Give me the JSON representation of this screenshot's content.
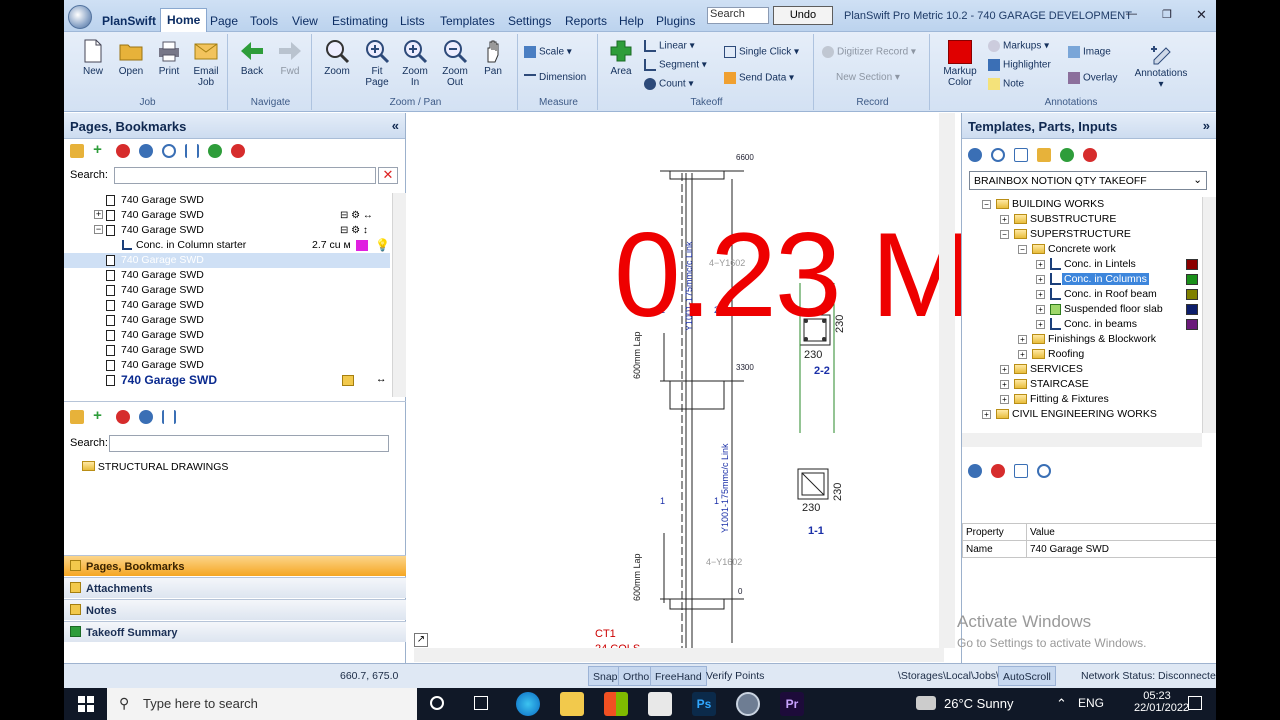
{
  "menubar": {
    "brand": "PlanSwift",
    "items": [
      "Home",
      "Page",
      "Tools",
      "View",
      "Estimating",
      "Lists",
      "Templates",
      "Settings",
      "Reports",
      "Help",
      "Plugins"
    ],
    "search_value": "Search",
    "undo": "Undo",
    "title": "PlanSwift Pro Metric 10.2 - 740 GARAGE DEVELOPMENT"
  },
  "ribbon": {
    "job": {
      "label": "Job",
      "new": "New",
      "open": "Open",
      "print": "Print",
      "email": "Email Job"
    },
    "navigate": {
      "label": "Navigate",
      "back": "Back",
      "fwd": "Fwd"
    },
    "zoom": {
      "label": "Zoom / Pan",
      "zoom": "Zoom",
      "fit": "Fit Page",
      "zoom_in": "Zoom In",
      "zoom_out": "Zoom Out",
      "pan": "Pan"
    },
    "measure": {
      "label": "Measure",
      "scale": "Scale",
      "dimension": "Dimension"
    },
    "takeoff": {
      "label": "Takeoff",
      "area": "Area",
      "linear": "Linear",
      "segment": "Segment",
      "count": "Count",
      "single_click": "Single Click",
      "send_data": "Send Data"
    },
    "record": {
      "label": "Record",
      "digitizer": "Digitizer Record",
      "new_section": "New Section"
    },
    "annotations": {
      "label": "Annotations",
      "markup_color": "Markup Color",
      "markups": "Markups",
      "highlighter": "Highlighter",
      "note": "Note",
      "image": "Image",
      "overlay": "Overlay",
      "annotations": "Annotations"
    }
  },
  "left_panel": {
    "title": "Pages, Bookmarks",
    "search_label": "Search:",
    "search_value": "",
    "pages": [
      {
        "name": "740 Garage SWD"
      },
      {
        "name": "740 Garage SWD"
      },
      {
        "name": "740 Garage SWD"
      },
      {
        "name": "Conc. in Column starter",
        "qty": "2.7 cu м"
      },
      {
        "name": "740 Garage SWD"
      },
      {
        "name": "740 Garage SWD"
      },
      {
        "name": "740 Garage SWD"
      },
      {
        "name": "740 Garage SWD"
      },
      {
        "name": "740 Garage SWD"
      },
      {
        "name": "740 Garage SWD"
      },
      {
        "name": "740 Garage SWD"
      },
      {
        "name": "740 Garage SWD"
      },
      {
        "name": "740 Garage SWD"
      }
    ],
    "search2_label": "Search:",
    "search2_value": "",
    "folders": [
      "STRUCTURAL DRAWINGS"
    ],
    "nav": [
      "Pages, Bookmarks",
      "Attachments",
      "Notes",
      "Takeoff Summary"
    ]
  },
  "canvas": {
    "overlay_value": "0.23 M",
    "labels": {
      "top_dim": "6600",
      "link1": "Y1001-175mmc/c Link",
      "mark1": "4−Y1602",
      "lap1": "600mm Lap",
      "lvl2": "3300",
      "link2": "Y1001-175mmc/c Link",
      "mark2": "4−Y1602",
      "lap2": "600mm Lap",
      "lvl0": "0",
      "sec22": "2-2",
      "sec11": "1-1",
      "dim230a": "230",
      "dim230b": "230",
      "dim230c": "230",
      "dim230d": "230",
      "ct1": "CT1",
      "cols": "24 COLS",
      "n2a": "2",
      "n2b": "2",
      "n1a": "1",
      "n1b": "1"
    }
  },
  "right_panel": {
    "title": "Templates, Parts, Inputs",
    "dropdown": "BRAINBOX NOTION QTY TAKEOFF",
    "tree": [
      {
        "name": "BUILDING WORKS",
        "level": 1,
        "type": "folder"
      },
      {
        "name": "SUBSTRUCTURE",
        "level": 2,
        "type": "folder"
      },
      {
        "name": "SUPERSTRUCTURE",
        "level": 2,
        "type": "folder"
      },
      {
        "name": "Concrete work",
        "level": 3,
        "type": "folder"
      },
      {
        "name": "Conc. in Lintels",
        "level": 4,
        "type": "takeoff",
        "color": "#8b0000"
      },
      {
        "name": "Conc. in Columns",
        "level": 4,
        "type": "takeoff",
        "color": "#1a8f1a"
      },
      {
        "name": "Conc. in Roof beam",
        "level": 4,
        "type": "takeoff",
        "color": "#808000"
      },
      {
        "name": "Suspended floor slab",
        "level": 4,
        "type": "area",
        "color": "#0d1e6b"
      },
      {
        "name": "Conc. in  beams",
        "level": 4,
        "type": "takeoff",
        "color": "#6b1a7a"
      },
      {
        "name": "Finishings & Blockwork",
        "level": 3,
        "type": "folder"
      },
      {
        "name": "Roofing",
        "level": 3,
        "type": "folder"
      },
      {
        "name": "SERVICES",
        "level": 2,
        "type": "folder"
      },
      {
        "name": "STAIRCASE",
        "level": 2,
        "type": "folder"
      },
      {
        "name": "Fitting & Fixtures",
        "level": 2,
        "type": "folder"
      },
      {
        "name": "CIVIL ENGINEERING WORKS",
        "level": 1,
        "type": "folder"
      }
    ],
    "props_header": [
      "Property",
      "Value"
    ],
    "props": [
      {
        "name": "Name",
        "value": "740 Garage SWD"
      }
    ],
    "watermark_1": "Activate Windows",
    "watermark_2": "Go to Settings to activate Windows."
  },
  "status": {
    "coords": "660.7, 675.0",
    "snap": "Snap",
    "ortho": "Ortho",
    "freehand": "FreeHand",
    "verify": "Verify Points",
    "path": "\\Storages\\Local\\Jobs\\",
    "autoscroll": "AutoScroll",
    "network": "Network Status: Disconnected"
  },
  "taskbar": {
    "search": "Type here to search",
    "weather": "26°C  Sunny",
    "lang": "ENG",
    "time": "05:23",
    "date": "22/01/2022"
  }
}
